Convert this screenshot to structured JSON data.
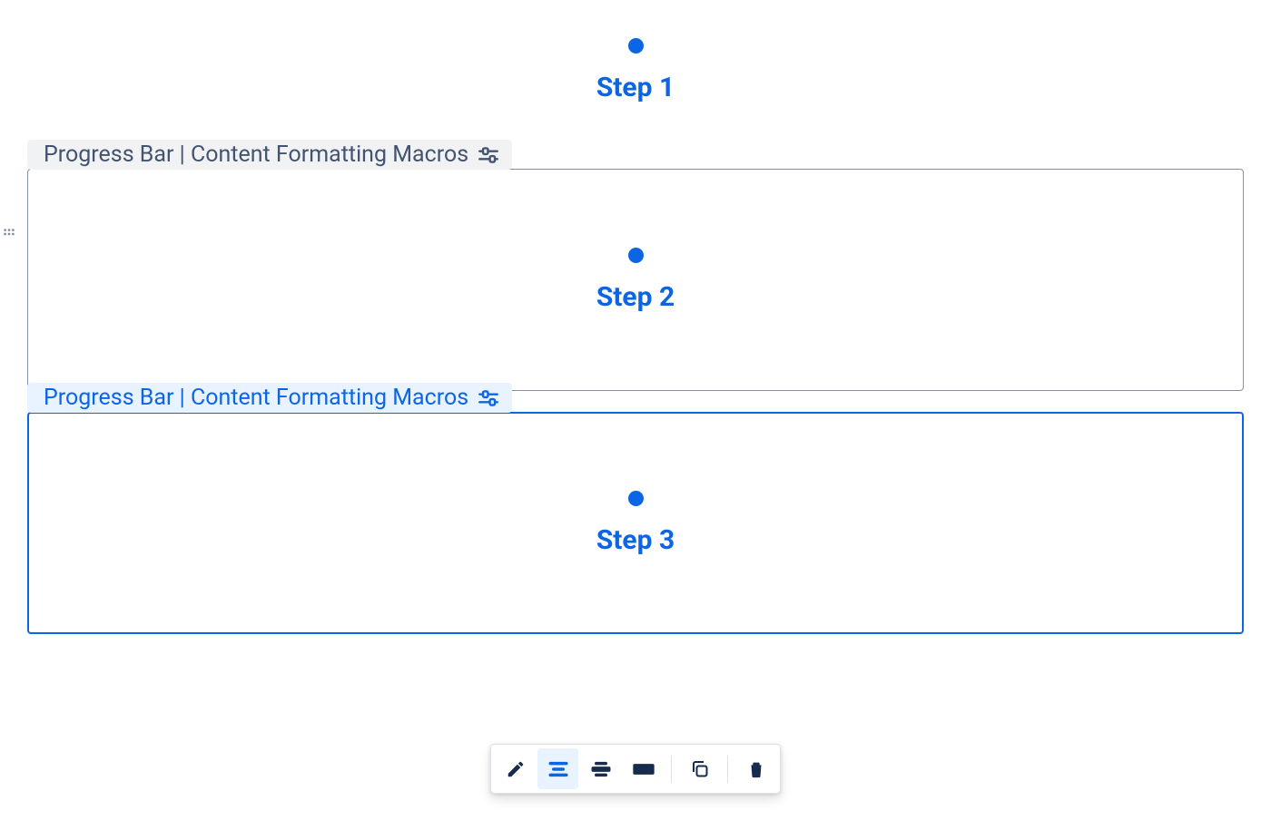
{
  "colors": {
    "accent": "#0c66e4",
    "muted_text": "#44546f",
    "tag_bg_inactive": "#f1f2f4",
    "tag_bg_active": "#e9f2ff",
    "border_inactive": "#8590a2"
  },
  "steps": {
    "step1_label": "Step 1",
    "step2_label": "Step 2",
    "step3_label": "Step 3"
  },
  "macros": {
    "tag1_label": "Progress Bar | Content Formatting Macros",
    "tag2_label": "Progress Bar | Content Formatting Macros"
  },
  "toolbar": {
    "edit_name": "edit",
    "align_center_name": "align-center",
    "align_wide_name": "align-wide",
    "align_full_name": "align-full",
    "copy_name": "copy",
    "delete_name": "delete"
  }
}
